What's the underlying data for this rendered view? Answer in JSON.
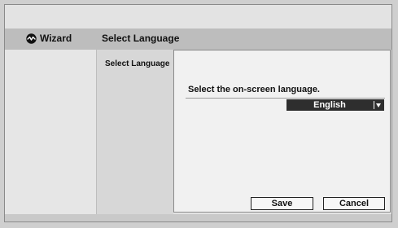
{
  "header": {
    "app_label": "Wizard",
    "title": "Select Language",
    "logo_icon": "wizard-logo-icon"
  },
  "steps": {
    "current_label": "Select Language"
  },
  "panel": {
    "prompt": "Select the on-screen language.",
    "language_select": {
      "selected": "English",
      "icon": "chevron-down-icon"
    },
    "buttons": {
      "save_label": "Save",
      "cancel_label": "Cancel"
    }
  },
  "colors": {
    "select_background": "#2e2e2e",
    "header_background": "#bdbdbd",
    "panel_background": "#f1f1f1"
  }
}
